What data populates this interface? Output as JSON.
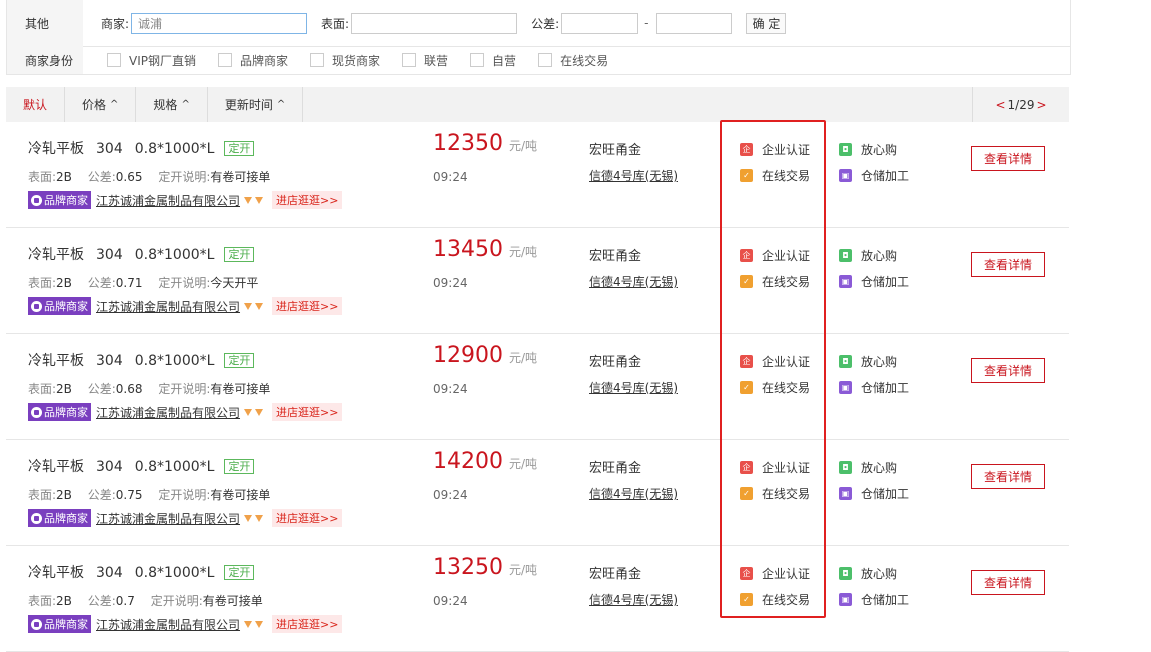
{
  "filter": {
    "other_label": "其他",
    "merchant_label": "商家:",
    "merchant_value": "诚浦",
    "surface_label": "表面:",
    "surface_value": "",
    "tolerance_label": "公差:",
    "tolerance_min": "",
    "tolerance_dash": "-",
    "tolerance_max": "",
    "confirm_label": "确 定",
    "identity_label": "商家身份",
    "identity_options": [
      "VIP钢厂直销",
      "品牌商家",
      "现货商家",
      "联营",
      "自营",
      "在线交易"
    ]
  },
  "sortbar": {
    "default": "默认",
    "price": "价格",
    "spec": "规格",
    "update_time": "更新时间",
    "arrow": "^",
    "pager_prev": "<",
    "pager_text": "1/29",
    "pager_next": ">"
  },
  "rows": [
    {
      "name": "冷轧平板",
      "grade": "304",
      "spec": "0.8*1000*L",
      "open_tag": "定开",
      "surface_label": "表面:",
      "surface": "2B",
      "tol_label": "公差:",
      "tol": "0.65",
      "note_label": "定开说明:",
      "note": "有卷可接单",
      "brand": "品牌商家",
      "company": "江苏诚浦金属制品有限公司",
      "visit": "进店逛逛>>",
      "price": "12350",
      "unit": "元/吨",
      "time": "09:24",
      "seller": "宏旺甬金",
      "warehouse": "信德4号库(无锡)",
      "svc1": "企业认证",
      "svc2": "在线交易",
      "svc3": "放心购",
      "svc4": "仓储加工",
      "detail": "查看详情"
    },
    {
      "name": "冷轧平板",
      "grade": "304",
      "spec": "0.8*1000*L",
      "open_tag": "定开",
      "surface_label": "表面:",
      "surface": "2B",
      "tol_label": "公差:",
      "tol": "0.71",
      "note_label": "定开说明:",
      "note": "今天开平",
      "brand": "品牌商家",
      "company": "江苏诚浦金属制品有限公司",
      "visit": "进店逛逛>>",
      "price": "13450",
      "unit": "元/吨",
      "time": "09:24",
      "seller": "宏旺甬金",
      "warehouse": "信德4号库(无锡)",
      "svc1": "企业认证",
      "svc2": "在线交易",
      "svc3": "放心购",
      "svc4": "仓储加工",
      "detail": "查看详情"
    },
    {
      "name": "冷轧平板",
      "grade": "304",
      "spec": "0.8*1000*L",
      "open_tag": "定开",
      "surface_label": "表面:",
      "surface": "2B",
      "tol_label": "公差:",
      "tol": "0.68",
      "note_label": "定开说明:",
      "note": "有卷可接单",
      "brand": "品牌商家",
      "company": "江苏诚浦金属制品有限公司",
      "visit": "进店逛逛>>",
      "price": "12900",
      "unit": "元/吨",
      "time": "09:24",
      "seller": "宏旺甬金",
      "warehouse": "信德4号库(无锡)",
      "svc1": "企业认证",
      "svc2": "在线交易",
      "svc3": "放心购",
      "svc4": "仓储加工",
      "detail": "查看详情"
    },
    {
      "name": "冷轧平板",
      "grade": "304",
      "spec": "0.8*1000*L",
      "open_tag": "定开",
      "surface_label": "表面:",
      "surface": "2B",
      "tol_label": "公差:",
      "tol": "0.75",
      "note_label": "定开说明:",
      "note": "有卷可接单",
      "brand": "品牌商家",
      "company": "江苏诚浦金属制品有限公司",
      "visit": "进店逛逛>>",
      "price": "14200",
      "unit": "元/吨",
      "time": "09:24",
      "seller": "宏旺甬金",
      "warehouse": "信德4号库(无锡)",
      "svc1": "企业认证",
      "svc2": "在线交易",
      "svc3": "放心购",
      "svc4": "仓储加工",
      "detail": "查看详情"
    },
    {
      "name": "冷轧平板",
      "grade": "304",
      "spec": "0.8*1000*L",
      "open_tag": "定开",
      "surface_label": "表面:",
      "surface": "2B",
      "tol_label": "公差:",
      "tol": "0.7",
      "note_label": "定开说明:",
      "note": "有卷可接单",
      "brand": "品牌商家",
      "company": "江苏诚浦金属制品有限公司",
      "visit": "进店逛逛>>",
      "price": "13250",
      "unit": "元/吨",
      "time": "09:24",
      "seller": "宏旺甬金",
      "warehouse": "信德4号库(无锡)",
      "svc1": "企业认证",
      "svc2": "在线交易",
      "svc3": "放心购",
      "svc4": "仓储加工",
      "detail": "查看详情"
    }
  ],
  "colors": {
    "accent": "#c9151e",
    "brand_purple": "#7a3fbf",
    "highlight": "#e02020"
  }
}
